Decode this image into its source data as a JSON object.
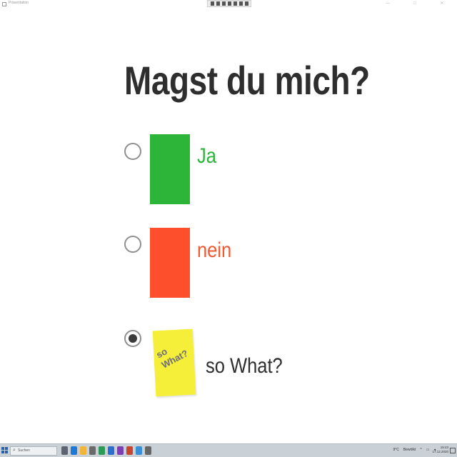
{
  "window": {
    "doc_title": "Präsentation",
    "controls": [
      "—",
      "□",
      "✕"
    ]
  },
  "slide": {
    "question": "Magst du mich?",
    "options": [
      {
        "label": "Ja",
        "color": "#2db53a",
        "label_color": "#2db53a",
        "selected": false
      },
      {
        "label": "nein",
        "color": "#fd4f2c",
        "label_color": "#f05a31",
        "selected": false
      },
      {
        "label": "so What?",
        "color": "#f6ef3a",
        "label_color": "#2e2e2e",
        "selected": true,
        "sticky_text": "so\nWhat?"
      }
    ]
  },
  "taskbar": {
    "search_placeholder": "Suchen",
    "icons": [
      "task-view-icon",
      "edge-icon",
      "explorer-icon",
      "store-icon",
      "chrome-icon",
      "mail-icon",
      "onenote-icon",
      "powerpoint-icon",
      "photos-icon",
      "settings-icon"
    ],
    "icon_colors": [
      "#5b6470",
      "#1f7ad6",
      "#f1b53b",
      "#6a6a6a",
      "#2e9a57",
      "#2a6fd0",
      "#7a3fb0",
      "#c8452e",
      "#3a8fd6",
      "#666666"
    ],
    "tray_temp": "9°C",
    "tray_weather": "Bewölkt",
    "time": "15:43",
    "date": "17.12.2020"
  }
}
